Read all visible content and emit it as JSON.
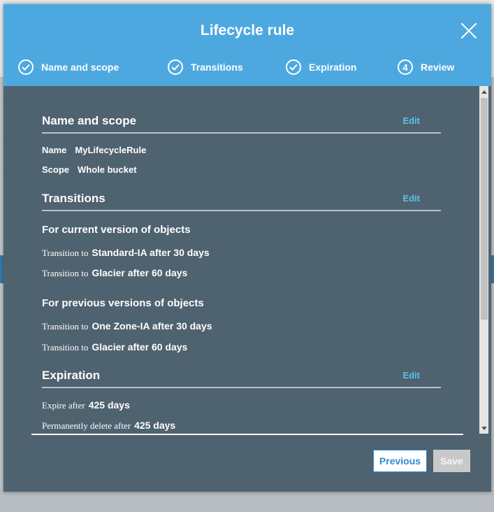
{
  "modal": {
    "title": "Lifecycle rule",
    "steps": [
      {
        "label": "Name and scope",
        "state": "done",
        "icon": "check-icon"
      },
      {
        "label": "Transitions",
        "state": "done",
        "icon": "check-icon"
      },
      {
        "label": "Expiration",
        "state": "done",
        "icon": "check-icon"
      },
      {
        "label": "Review",
        "state": "current",
        "number": "4"
      }
    ]
  },
  "review": {
    "name_scope": {
      "heading": "Name and scope",
      "edit": "Edit",
      "name_label": "Name",
      "name_value": "MyLifecycleRule",
      "scope_label": "Scope",
      "scope_value": "Whole bucket"
    },
    "transitions": {
      "heading": "Transitions",
      "edit": "Edit",
      "current_heading": "For current version of objects",
      "current": [
        {
          "prefix": "Transition to",
          "value": "Standard-IA after 30 days"
        },
        {
          "prefix": "Transition to",
          "value": "Glacier after 60 days"
        }
      ],
      "previous_heading": "For previous versions of objects",
      "previous": [
        {
          "prefix": "Transition to",
          "value": "One Zone-IA after 30 days"
        },
        {
          "prefix": "Transition to",
          "value": "Glacier after 60 days"
        }
      ]
    },
    "expiration": {
      "heading": "Expiration",
      "edit": "Edit",
      "expire_prefix": "Expire after",
      "expire_value": "425 days",
      "delete_prefix": "Permanently delete after",
      "delete_value": "425 days"
    }
  },
  "footer": {
    "previous": "Previous",
    "save": "Save"
  },
  "colors": {
    "header": "#4ea8e0",
    "body": "#4f626f",
    "edit_link": "#5cc0ee",
    "primary": "#2b8dd6"
  }
}
